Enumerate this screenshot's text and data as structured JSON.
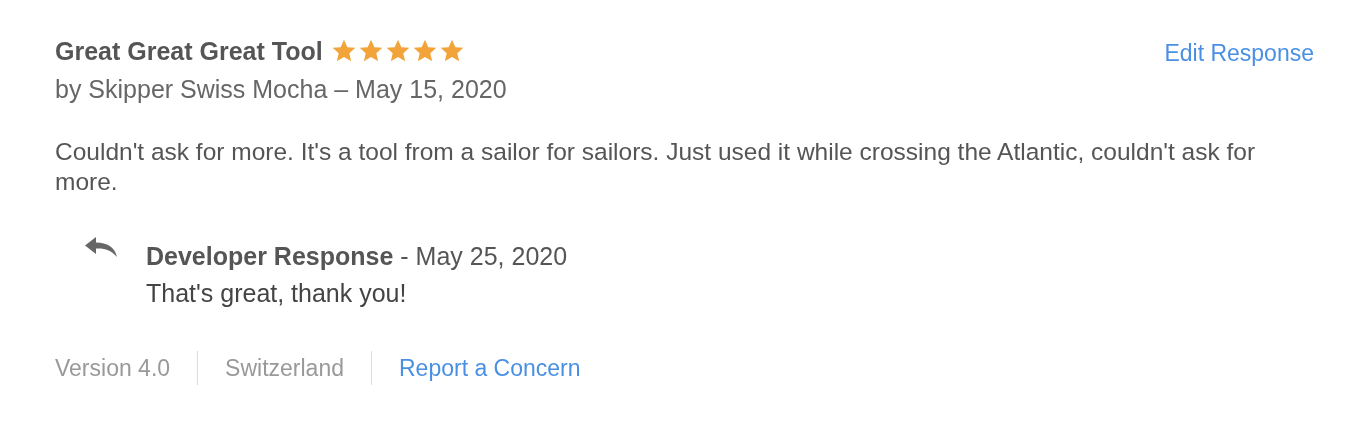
{
  "review": {
    "title": "Great Great Great Tool",
    "stars": 5,
    "byline": "by Skipper Swiss Mocha – May 15, 2020",
    "body": "Couldn't ask for more. It's a tool from a sailor for sailors. Just used it while crossing the Atlantic, couldn't ask for more."
  },
  "edit_link": "Edit Response",
  "developer_response": {
    "heading": "Developer Response",
    "date": "- May 25, 2020",
    "text": "That's great, thank you!"
  },
  "footer": [
    {
      "kind": "text",
      "label": "Version 4.0"
    },
    {
      "kind": "text",
      "label": "Switzerland"
    },
    {
      "kind": "link",
      "label": "Report a Concern"
    }
  ]
}
